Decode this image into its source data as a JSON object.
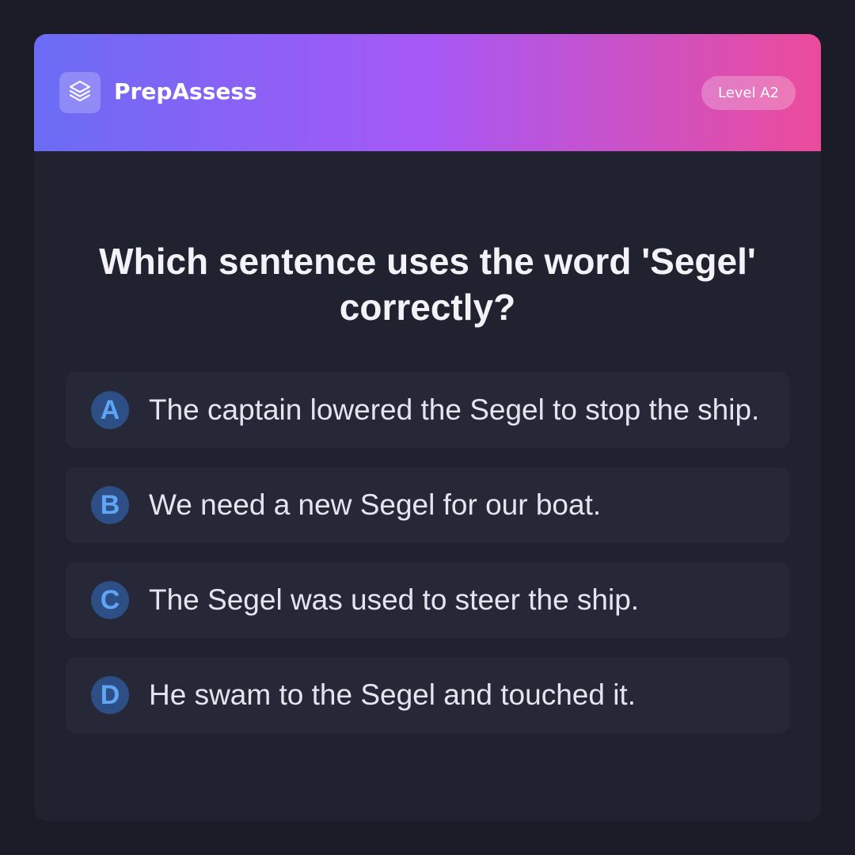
{
  "header": {
    "brand": "PrepAssess",
    "logo_icon": "layers-icon",
    "level_badge": "Level A2",
    "gradient_colors": [
      "#6a6cf5",
      "#a758f6",
      "#ec4b9a"
    ]
  },
  "question": {
    "text": "Which sentence uses the word 'Segel' correctly?"
  },
  "options": [
    {
      "letter": "A",
      "text": "The captain lowered the Segel to stop the ship."
    },
    {
      "letter": "B",
      "text": "We need a new Segel for our boat."
    },
    {
      "letter": "C",
      "text": "The Segel was used to steer the ship."
    },
    {
      "letter": "D",
      "text": "He swam to the Segel and touched it."
    }
  ],
  "colors": {
    "page_background": "#1b1c27",
    "card_background": "#202230",
    "option_background": "#262837",
    "letter_badge": "#2d4f85",
    "letter_text": "#5ea6f5"
  }
}
